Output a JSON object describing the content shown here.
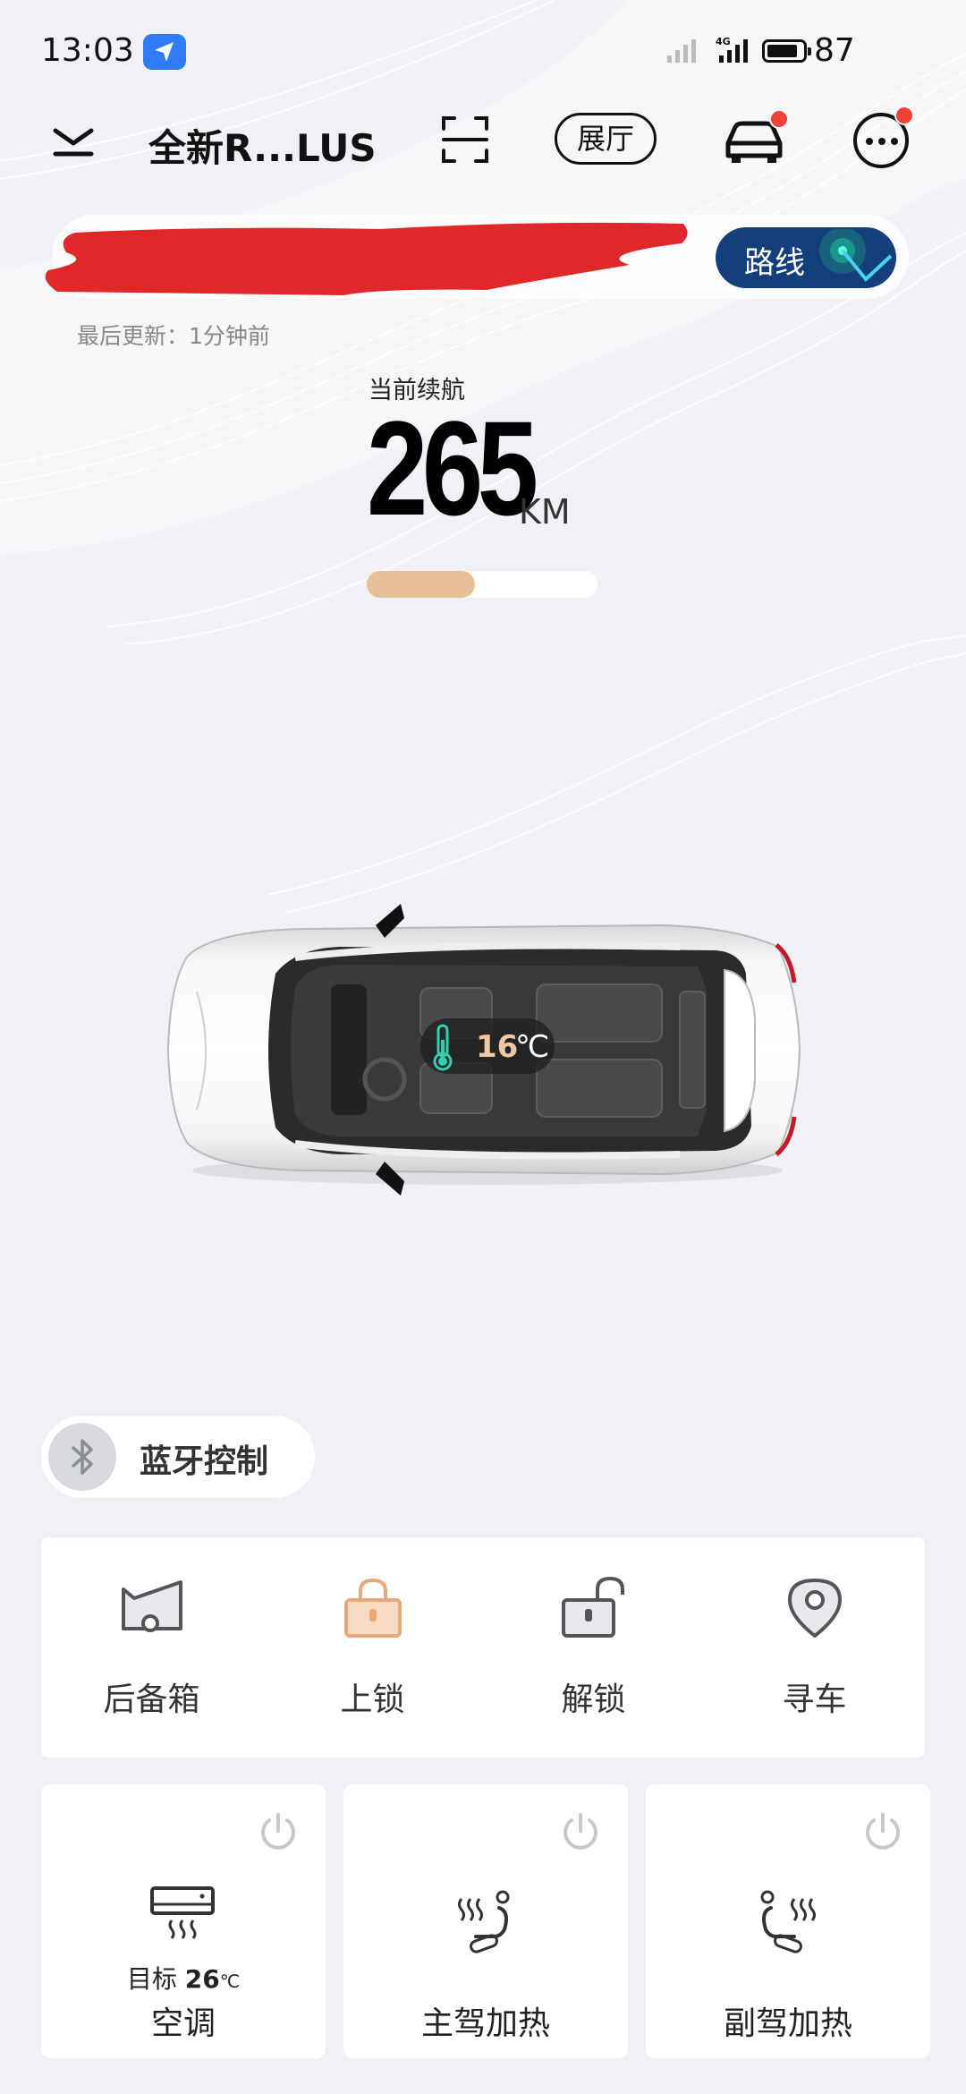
{
  "status_bar": {
    "time": "13:03",
    "network": "4G",
    "battery": "87",
    "battery_level": 0.87
  },
  "header": {
    "title": "全新R...LUS",
    "showroom_label": "展厅",
    "icons": [
      "collapse-chevron-icon",
      "scan-icon",
      "car-icon",
      "more-icon"
    ]
  },
  "location": {
    "route_label": "路线",
    "last_update": "最后更新：1分钟前"
  },
  "range": {
    "label": "当前续航",
    "value": "265",
    "unit": "KM",
    "level": 0.47
  },
  "cabin": {
    "temp_value": "16",
    "temp_unit": "℃"
  },
  "bluetooth": {
    "label": "蓝牙控制"
  },
  "quick_actions": [
    {
      "label": "后备箱",
      "icon": "trunk-icon"
    },
    {
      "label": "上锁",
      "icon": "lock-icon"
    },
    {
      "label": "解锁",
      "icon": "unlock-icon"
    },
    {
      "label": "寻车",
      "icon": "find-car-icon"
    }
  ],
  "tiles": [
    {
      "label": "空调",
      "target_prefix": "目标",
      "target_value": "26",
      "target_unit": "℃",
      "icon": "air-conditioner-icon"
    },
    {
      "label": "主驾加热",
      "icon": "driver-seat-heat-icon"
    },
    {
      "label": "副驾加热",
      "icon": "passenger-seat-heat-icon"
    }
  ],
  "colors": {
    "accent_blue": "#133f7c",
    "range_fill": "#e8c097",
    "notification_dot": "#f2403a",
    "lock_orange": "#e8a878",
    "redaction": "#e0282a"
  }
}
